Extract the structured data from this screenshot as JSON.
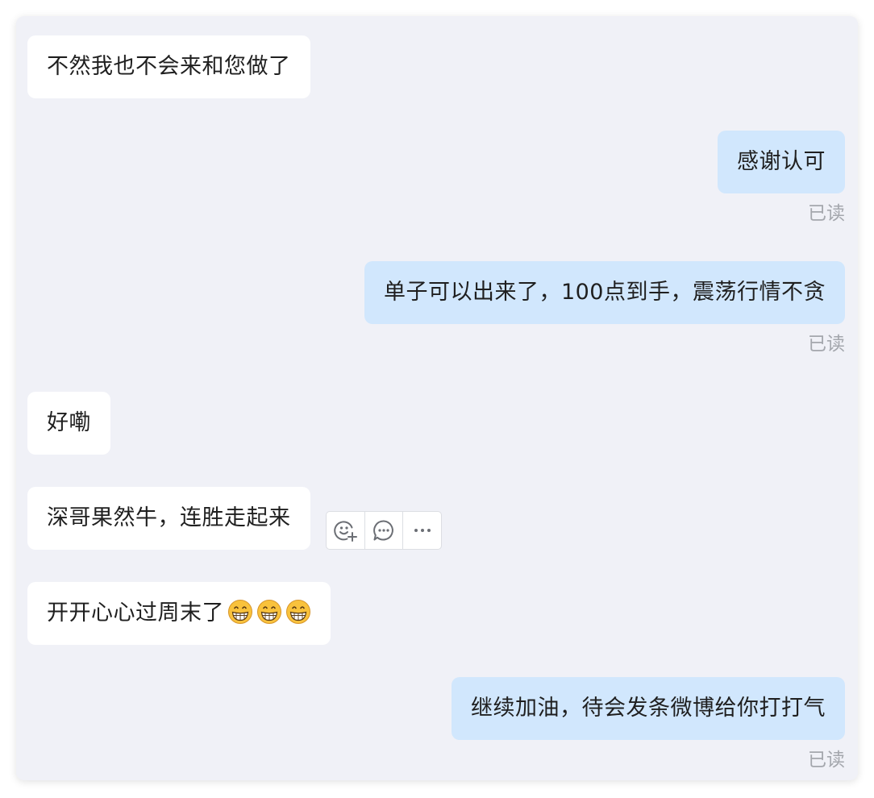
{
  "messages": [
    {
      "direction": "incoming",
      "text": "不然我也不会来和您做了"
    },
    {
      "direction": "outgoing",
      "text": "感谢认可",
      "status": "已读"
    },
    {
      "direction": "outgoing",
      "text": "单子可以出来了，100点到手，震荡行情不贪",
      "status": "已读"
    },
    {
      "direction": "incoming",
      "text": "好嘞"
    },
    {
      "direction": "incoming",
      "text": "深哥果然牛，连胜走起来"
    },
    {
      "direction": "incoming",
      "text": "开开心心过周末了",
      "emojis": [
        "grinning-face",
        "grinning-face",
        "grinning-face"
      ]
    },
    {
      "direction": "outgoing",
      "text": "继续加油，待会发条微博给你打打气",
      "status": "已读"
    }
  ],
  "hover_toolbar": {
    "icons": [
      "add-reaction-icon",
      "reply-icon",
      "more-icon"
    ]
  },
  "colors": {
    "panel_background": "#f0f1f7",
    "incoming_bubble": "#ffffff",
    "outgoing_bubble": "#d1e7fd",
    "read_status_text": "#a4a7ad"
  }
}
